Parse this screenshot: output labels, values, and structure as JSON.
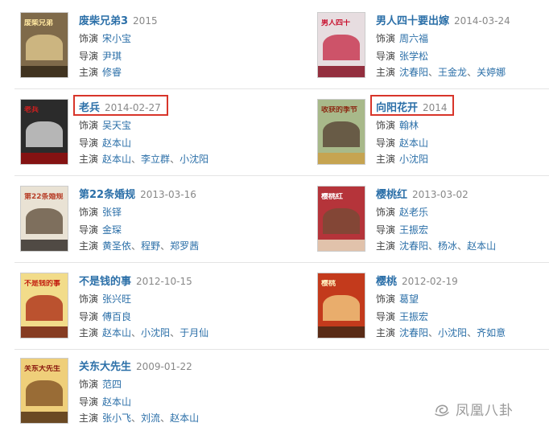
{
  "labels": {
    "actor": "饰演",
    "director": "导演",
    "star": "主演"
  },
  "movies": [
    {
      "title": "废柴兄弟3",
      "date": "2015",
      "role": "宋小宝",
      "director": "尹琪",
      "cast": [
        "修睿"
      ],
      "poster": {
        "bg": "#7f6a4a",
        "fg": "#d9c28a",
        "band": "#3a2e1c",
        "text": "废柴兄弟",
        "text_color": "#ffe7a0"
      }
    },
    {
      "title": "男人四十要出嫁",
      "date": "2014-03-24",
      "role": "周六福",
      "director": "张学松",
      "cast": [
        "沈春阳",
        "王金龙",
        "关婷娜"
      ],
      "poster": {
        "bg": "#e7dde0",
        "fg": "#c83b54",
        "band": "#8a1c2c",
        "text": "男人四十",
        "text_color": "#c8102e"
      }
    },
    {
      "title": "老兵",
      "date": "2014-02-27",
      "role": "吴天宝",
      "director": "赵本山",
      "cast": [
        "赵本山",
        "李立群",
        "小沈阳"
      ],
      "poster": {
        "bg": "#2b2b2b",
        "fg": "#cfcfcf",
        "band": "#8e1010",
        "text": "老兵",
        "text_color": "#d21f1f"
      }
    },
    {
      "title": "向阳花开",
      "date": "2014",
      "role": "翰林",
      "director": "赵本山",
      "cast": [
        "小沈阳"
      ],
      "poster": {
        "bg": "#a8b98a",
        "fg": "#5d4a3a",
        "band": "#c9a24a",
        "text": "收获的季节",
        "text_color": "#8c2a14"
      }
    },
    {
      "title": "第22条婚规",
      "date": "2013-03-16",
      "role": "张铎",
      "director": "金琛",
      "cast": [
        "黄圣依",
        "程野",
        "郑罗茜"
      ],
      "poster": {
        "bg": "#e9e2d4",
        "fg": "#6b5a48",
        "band": "#3f3a34",
        "text": "第22条婚规",
        "text_color": "#b8402a"
      }
    },
    {
      "title": "樱桃红",
      "date": "2013-03-02",
      "role": "赵老乐",
      "director": "王振宏",
      "cast": [
        "沈春阳",
        "杨冰",
        "赵本山"
      ],
      "poster": {
        "bg": "#b5343a",
        "fg": "#7a4a36",
        "band": "#e6d2b8",
        "text": "樱桃红",
        "text_color": "#ffffff"
      }
    },
    {
      "title": "不是钱的事",
      "date": "2012-10-15",
      "role": "张兴旺",
      "director": "傅百良",
      "cast": [
        "赵本山",
        "小沈阳",
        "于月仙"
      ],
      "poster": {
        "bg": "#f2dc8a",
        "fg": "#b23a1e",
        "band": "#7a2a16",
        "text": "不是钱的事",
        "text_color": "#c21f10"
      }
    },
    {
      "title": "樱桃",
      "date": "2012-02-19",
      "role": "葛望",
      "director": "王振宏",
      "cast": [
        "沈春阳",
        "小沈阳",
        "齐如意"
      ],
      "poster": {
        "bg": "#c33a1c",
        "fg": "#f0c27a",
        "band": "#4e2a16",
        "text": "樱桃",
        "text_color": "#fff2c0"
      }
    },
    {
      "title": "关东大先生",
      "date": "2009-01-22",
      "role": "范四",
      "director": "赵本山",
      "cast": [
        "张小飞",
        "刘流",
        "赵本山"
      ],
      "poster": {
        "bg": "#efcf7a",
        "fg": "#8a5a2a",
        "band": "#5b3a1a",
        "text": "关东大先生",
        "text_color": "#8a1a10"
      }
    }
  ],
  "watermark": {
    "text": "凤凰八卦",
    "icon": "swirl-logo-icon"
  },
  "colors": {
    "link": "#2b6fa8",
    "highlight_border": "#d8352a",
    "date": "#888888"
  }
}
